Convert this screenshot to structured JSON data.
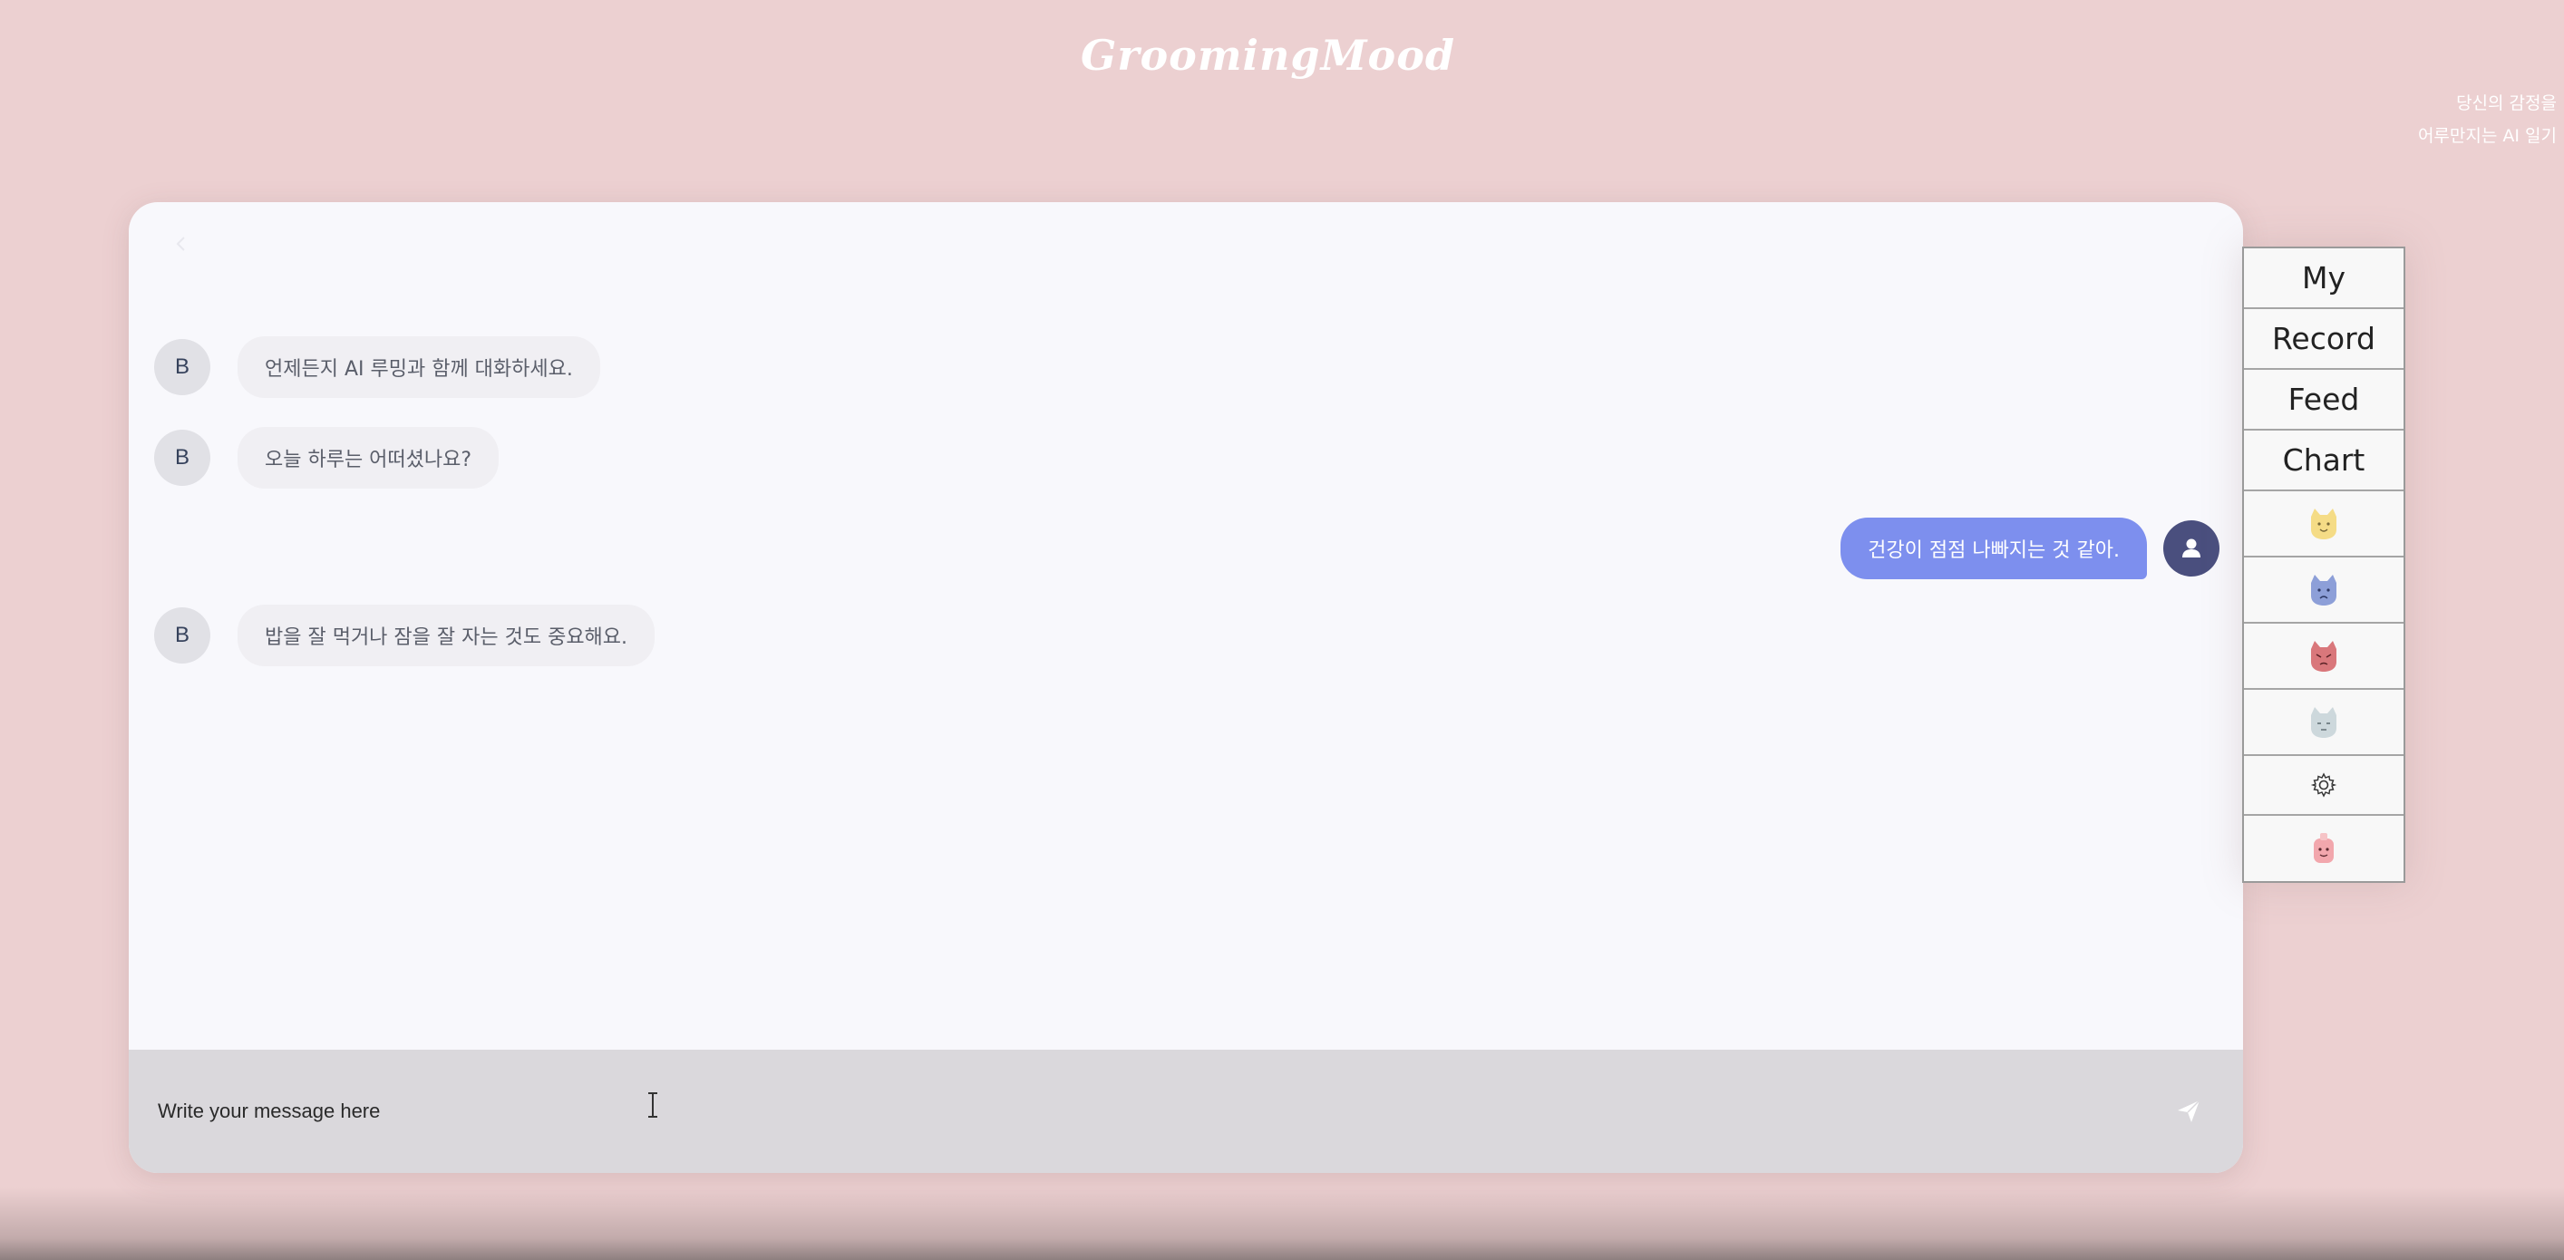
{
  "app": {
    "logo": "GroomingMood",
    "tagline_line1": "당신의 감정을",
    "tagline_line2": "어루만지는 AI 일기"
  },
  "chat": {
    "bot_avatar_letter": "B",
    "messages": [
      {
        "sender": "bot",
        "text": "언제든지 AI 루밍과 함께 대화하세요."
      },
      {
        "sender": "bot",
        "text": "오늘 하루는 어떠셨나요?"
      },
      {
        "sender": "user",
        "text": "건강이 점점 나빠지는 것 같아."
      },
      {
        "sender": "bot",
        "text": "밥을 잘 먹거나 잠을 잘 자는 것도 중요해요."
      }
    ],
    "input_placeholder": "Write your message here"
  },
  "side_menu": {
    "items": [
      {
        "label": "My"
      },
      {
        "label": "Record"
      },
      {
        "label": "Feed"
      },
      {
        "label": "Chart"
      }
    ],
    "icons": [
      {
        "name": "yellow-cat-face-icon",
        "color": "#f5dc86"
      },
      {
        "name": "blue-cat-face-icon",
        "color": "#8d9fd8"
      },
      {
        "name": "red-cat-face-icon",
        "color": "#d9777b"
      },
      {
        "name": "gray-cat-face-icon",
        "color": "#cdd8dc"
      },
      {
        "name": "gear-icon",
        "color": "#333333"
      },
      {
        "name": "pink-character-icon",
        "color": "#f2a7ad"
      }
    ]
  },
  "colors": {
    "background": "#ecd0d1",
    "user_bubble": "#7d8fee",
    "user_avatar": "#4a4f7e"
  }
}
